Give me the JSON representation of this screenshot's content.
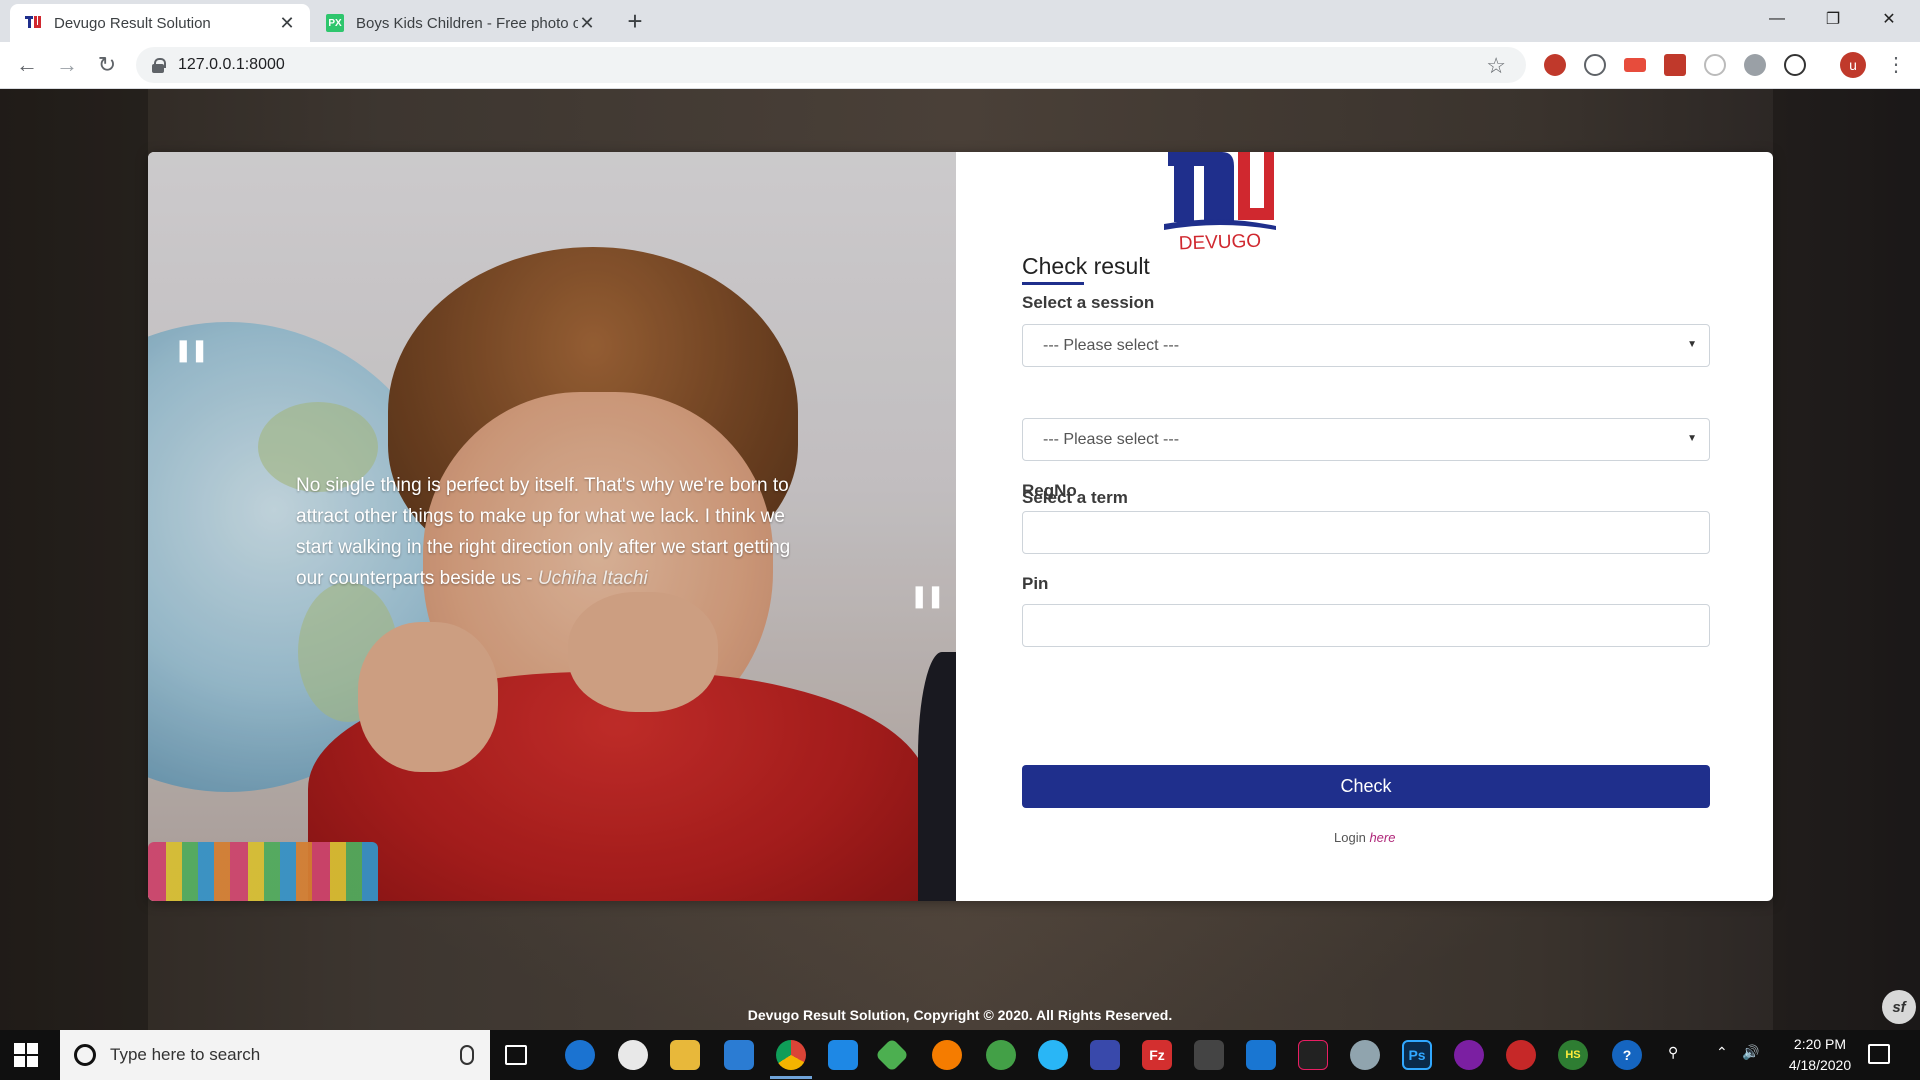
{
  "browser": {
    "tabs": [
      {
        "title": "Devugo Result Solution",
        "favicon": "devugo-logo-icon",
        "active": true
      },
      {
        "title": "Boys Kids Children - Free photo o",
        "favicon": "pixabay-px-icon",
        "favicon_text": "PX",
        "active": false
      }
    ],
    "url": "127.0.0.1:8000",
    "profile_initial": "u"
  },
  "quote": {
    "text": "No single thing is perfect by itself. That's why we're born to attract other things to make up for what we lack. I think we start walking in the right direction only after we start getting our counterparts beside us",
    "separator": " - ",
    "author": "Uchiha Itachi",
    "open_mark": "❚❚",
    "close_mark": "❚❚"
  },
  "logo": {
    "text": "DEVUGO",
    "colors": {
      "blue": "#1f2f8c",
      "red": "#d0282f"
    }
  },
  "form": {
    "title": "Check result",
    "session_label": "Select a session",
    "session_value": "--- Please select ---",
    "term_label": "Select a term",
    "term_value": "--- Please select ---",
    "regno_label": "RegNo",
    "pin_label": "Pin",
    "submit_label": "Check",
    "login_prefix": "Login",
    "login_link": "here"
  },
  "footer": {
    "text": "Devugo Result Solution, Copyright © 2020. All Rights Reserved.",
    "badge": "sf"
  },
  "taskbar": {
    "search_placeholder": "Type here to search",
    "time": "2:20 PM",
    "date": "4/18/2020",
    "filezilla_label": "Fz",
    "photoshop_label": "Ps",
    "hubspot_label": "HS",
    "help_label": "?"
  },
  "colors": {
    "accent": "#1f2f8c",
    "link": "#b0287a"
  }
}
